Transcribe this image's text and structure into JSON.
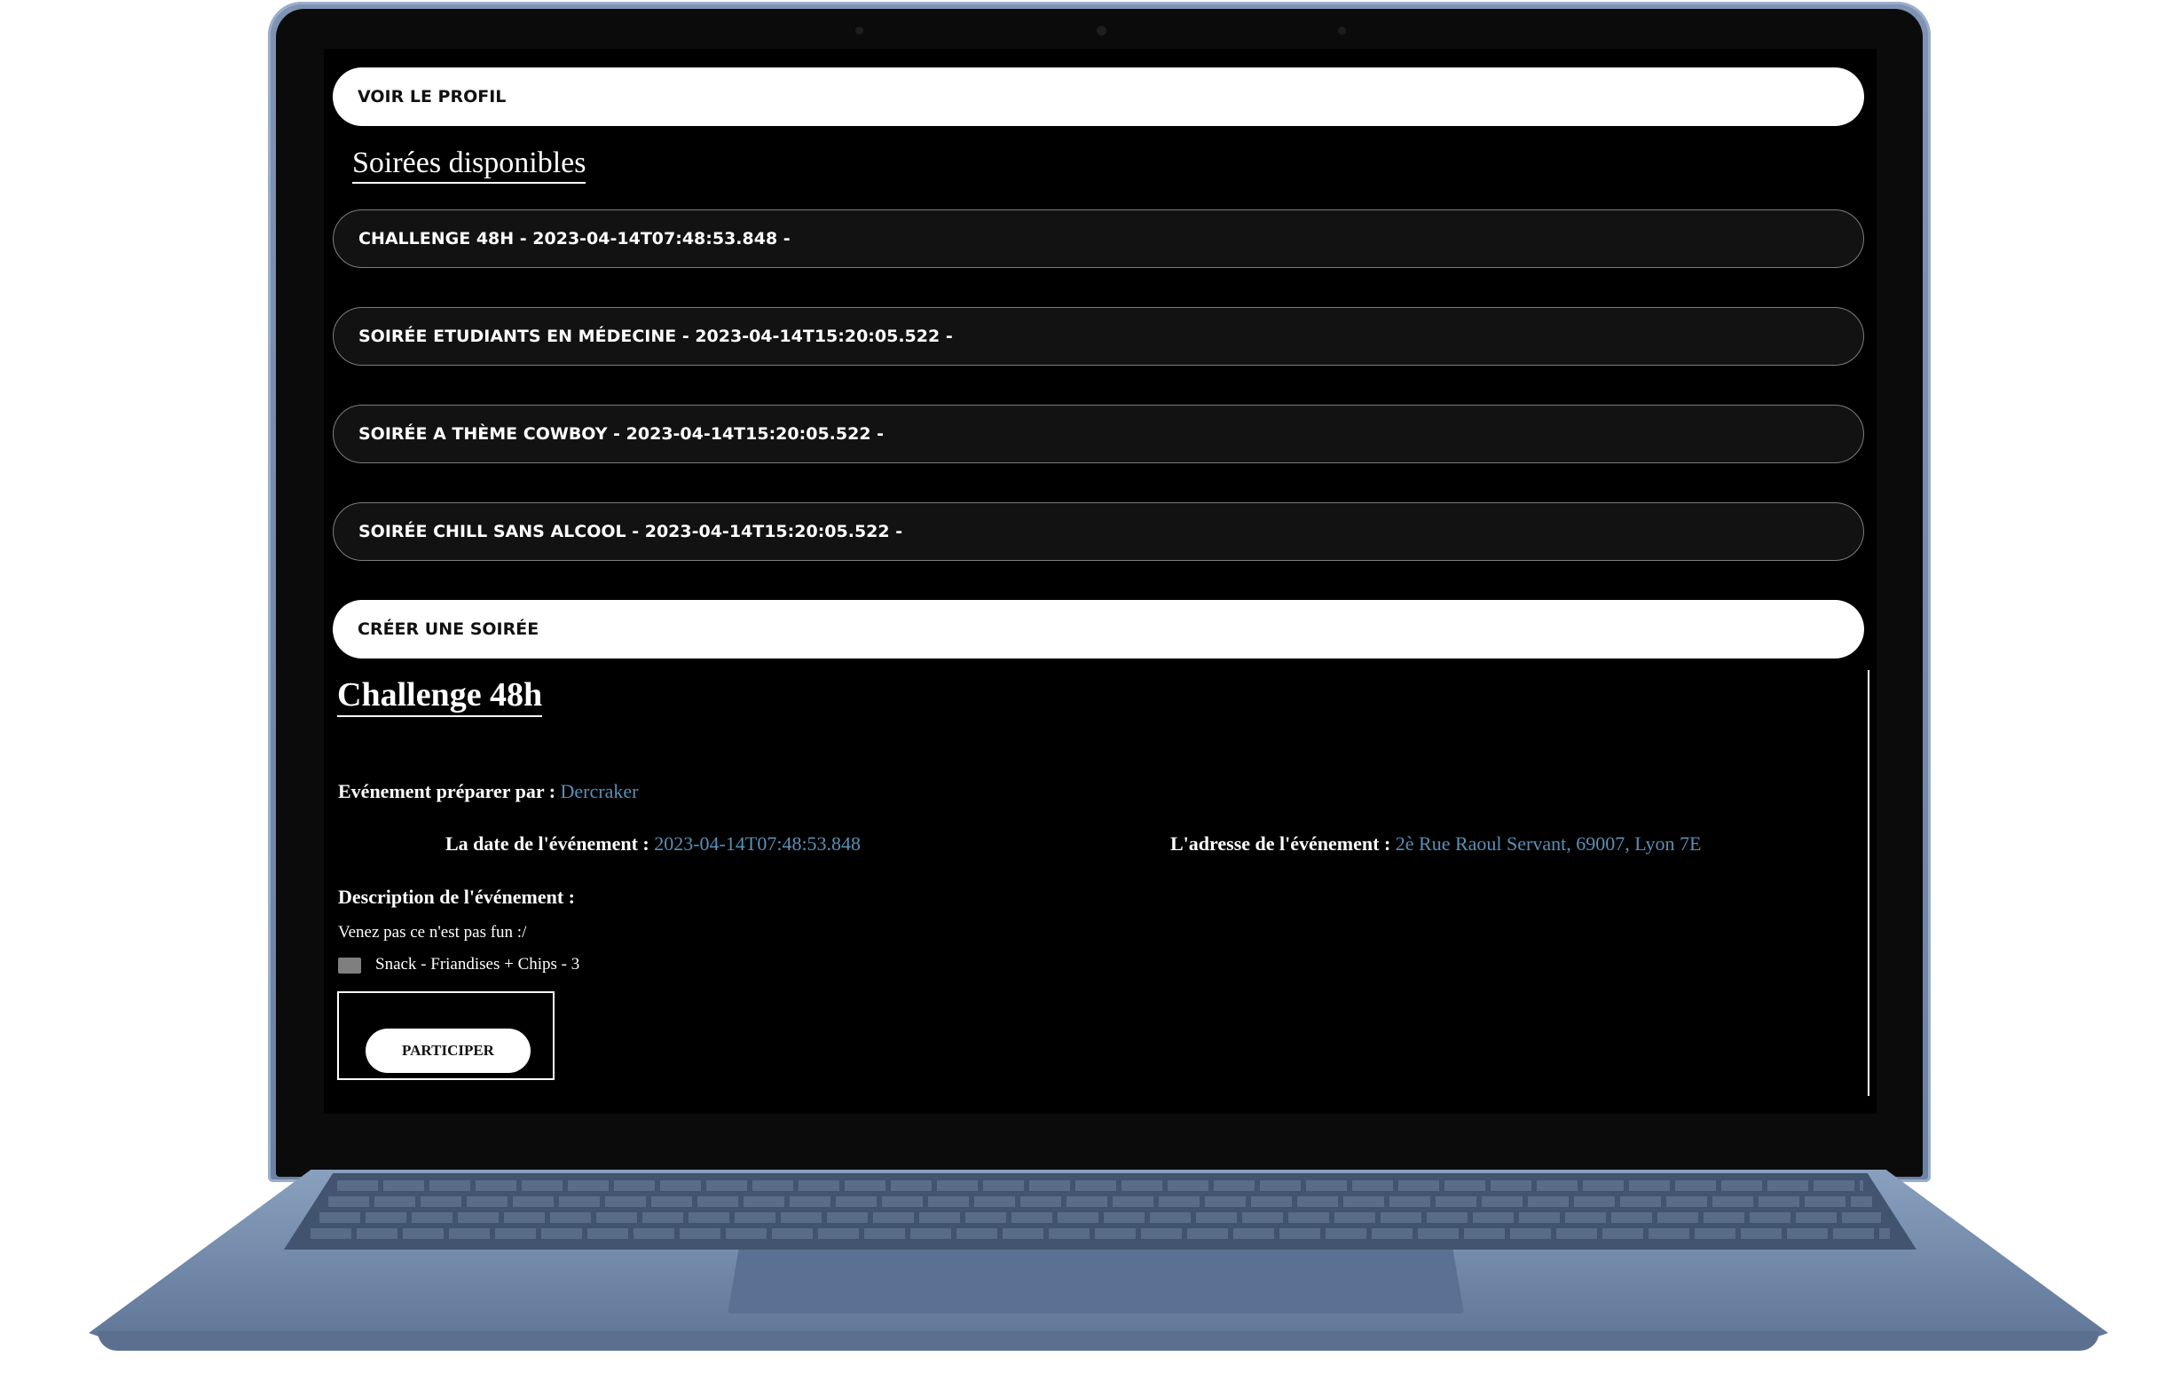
{
  "nav": {
    "profile_button": "VOIR LE PROFIL",
    "create_button": "CRÉER UNE SOIRÉE"
  },
  "list": {
    "title": "Soirées disponibles",
    "items": [
      {
        "label": "CHALLENGE 48H - 2023-04-14T07:48:53.848 -"
      },
      {
        "label": "SOIRÉE ETUDIANTS EN MÉDECINE - 2023-04-14T15:20:05.522 -"
      },
      {
        "label": "SOIRÉE A THÈME COWBOY - 2023-04-14T15:20:05.522 -"
      },
      {
        "label": "SOIRÉE CHILL SANS ALCOOL - 2023-04-14T15:20:05.522 -"
      }
    ]
  },
  "event": {
    "title": "Challenge 48h",
    "organizer_label": "Evénement préparer par :",
    "organizer": "Dercraker",
    "date_label": "La date de l'événement :",
    "date": "2023-04-14T07:48:53.848",
    "address_label": "L'adresse de l'événement :",
    "address": "2è Rue Raoul Servant, 69007, Lyon 7E",
    "description_label": "Description de l'événement :",
    "description": "Venez pas ce n'est pas fun :/",
    "item_label": "Snack - Friandises + Chips - 3",
    "item_checked": false,
    "participate_button": "PARTICIPER"
  },
  "colors": {
    "accent": "#5a8fb5",
    "screen_background": "#000000",
    "laptop_body": "#7f93b3"
  }
}
